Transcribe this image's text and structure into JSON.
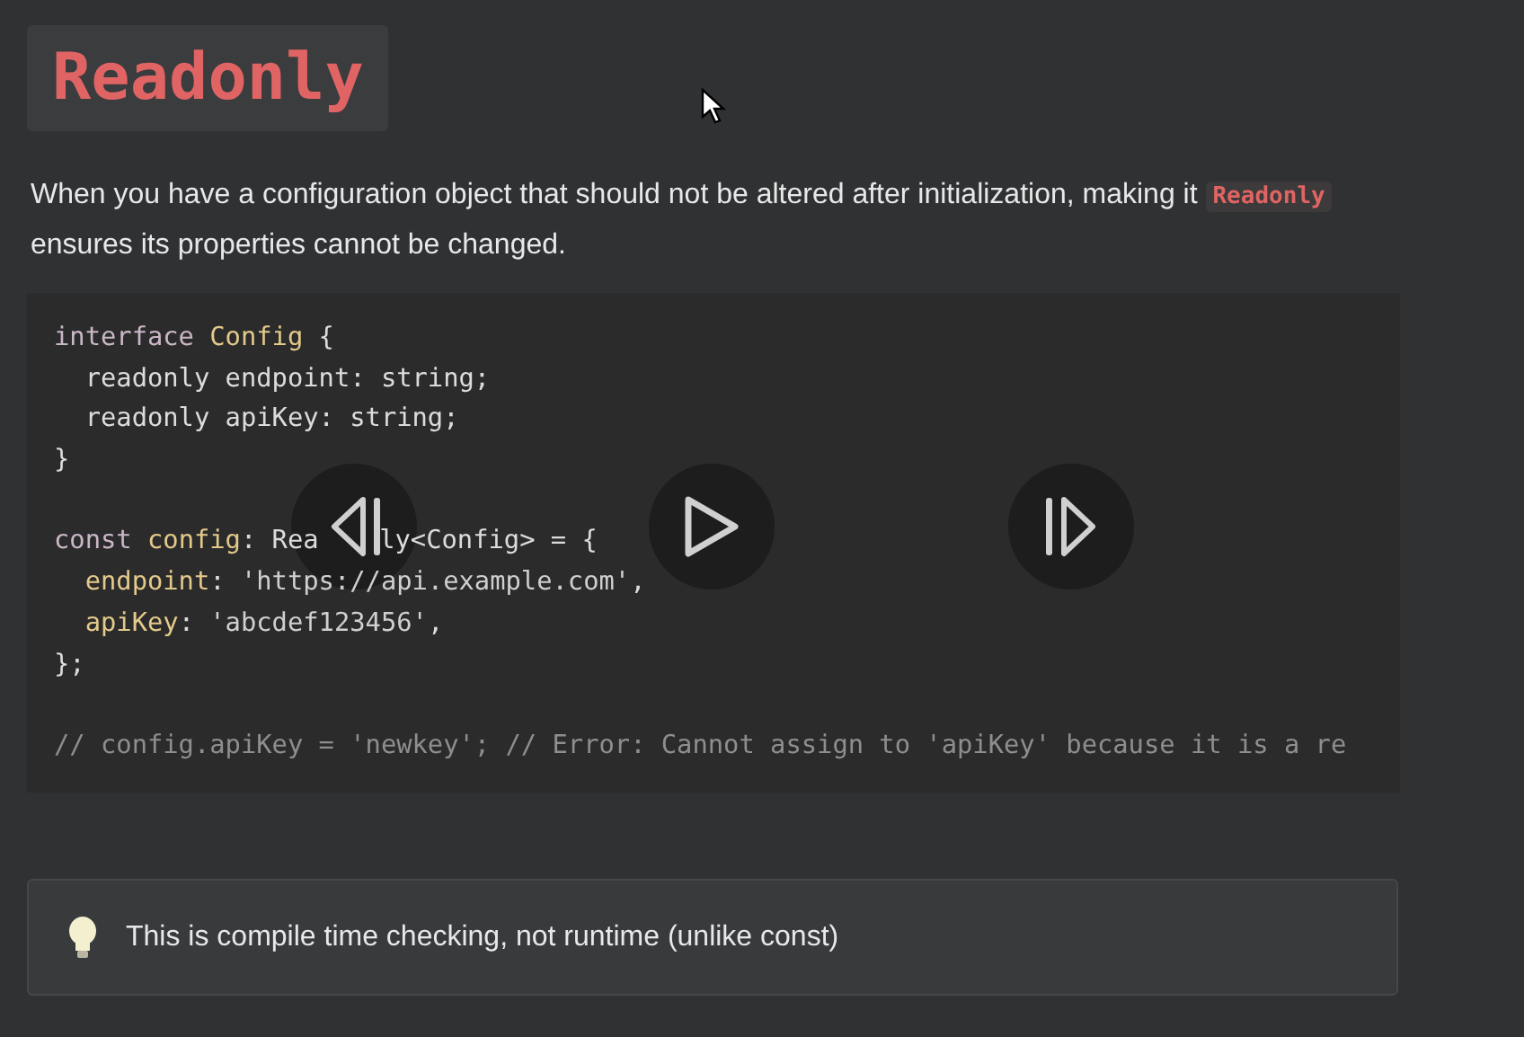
{
  "title": "Readonly",
  "intro": {
    "before": "When you have a configuration object that should not be altered after initialization, making it ",
    "code": "Readonly",
    "after": " ensures its properties cannot be changed."
  },
  "code_lines": [
    {
      "blank_before": false,
      "segments": [
        [
          {
            "kind": "keyword",
            "text": "interface"
          },
          {
            "kind": "type",
            "text": " Config"
          },
          {
            "kind": "plain",
            "text": " {"
          }
        ]
      ]
    },
    {
      "blank_before": false,
      "segments": [
        [
          {
            "kind": "plain",
            "text": "  readonly endpoint: string;"
          }
        ]
      ]
    },
    {
      "blank_before": false,
      "segments": [
        [
          {
            "kind": "plain",
            "text": "  readonly apiKey: string;"
          }
        ]
      ]
    },
    {
      "blank_before": false,
      "segments": [
        [
          {
            "kind": "plain",
            "text": "}"
          }
        ]
      ]
    },
    {
      "blank_before": true,
      "segments": [
        [
          {
            "kind": "keyword",
            "text": "const"
          },
          {
            "kind": "type",
            "text": " config"
          },
          {
            "kind": "plain",
            "text": ": Rea"
          }
        ],
        [
          {
            "kind": "plain",
            "text": "ly<Config> = {"
          }
        ]
      ]
    },
    {
      "blank_before": false,
      "segments": [
        [
          {
            "kind": "type",
            "text": "  endpoint"
          },
          {
            "kind": "plain",
            "text": ": "
          },
          {
            "kind": "string",
            "text": "'https://api.example.com'"
          },
          {
            "kind": "plain",
            "text": ","
          }
        ]
      ]
    },
    {
      "blank_before": false,
      "segments": [
        [
          {
            "kind": "type",
            "text": "  apiKey"
          },
          {
            "kind": "plain",
            "text": ": "
          },
          {
            "kind": "string",
            "text": "'abcdef123456'"
          },
          {
            "kind": "plain",
            "text": ","
          }
        ]
      ]
    },
    {
      "blank_before": false,
      "segments": [
        [
          {
            "kind": "plain",
            "text": "};"
          }
        ]
      ]
    },
    {
      "blank_before": true,
      "segments": [
        [
          {
            "kind": "comment",
            "text": "// config.apiKey = 'newkey'; // Error: Cannot assign to 'apiKey' because it is a re"
          }
        ]
      ]
    }
  ],
  "player_controls": [
    {
      "kind": "previous"
    },
    {
      "kind": "play"
    },
    {
      "kind": "next"
    }
  ],
  "tip": {
    "text": "This is compile time checking, not runtime (unlike const)"
  }
}
